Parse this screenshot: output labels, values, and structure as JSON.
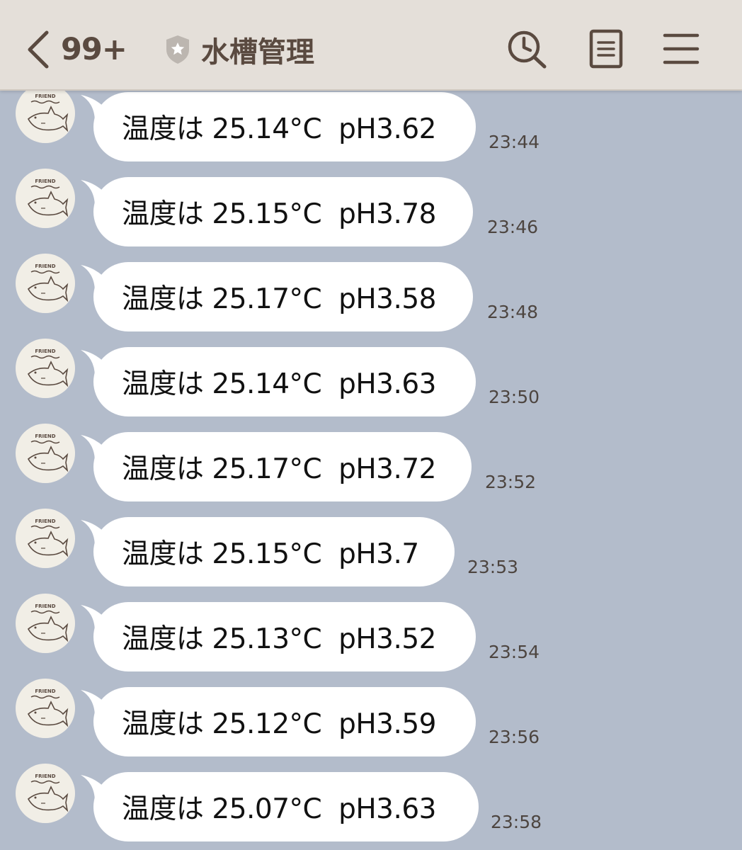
{
  "header": {
    "unread_count": "99+",
    "title": "水槽管理",
    "icons": [
      "back-chevron-icon",
      "shield-star-icon",
      "search-clock-icon",
      "notes-icon",
      "menu-icon"
    ],
    "background": "#e4dfd9",
    "text_color": "#5a4a40"
  },
  "chat": {
    "background": "#b3bccb",
    "avatar_label": "FRIEND",
    "avatar_icon": "shark-icon",
    "messages": [
      {
        "text": "温度は 25.14°C  pH3.62",
        "time": "23:44"
      },
      {
        "text": "温度は 25.15°C  pH3.78",
        "time": "23:46"
      },
      {
        "text": "温度は 25.17°C  pH3.58",
        "time": "23:48"
      },
      {
        "text": "温度は 25.14°C  pH3.63",
        "time": "23:50"
      },
      {
        "text": "温度は 25.17°C  pH3.72",
        "time": "23:52"
      },
      {
        "text": "温度は 25.15°C  pH3.7",
        "time": "23:53"
      },
      {
        "text": "温度は 25.13°C  pH3.52",
        "time": "23:54"
      },
      {
        "text": "温度は 25.12°C  pH3.59",
        "time": "23:56"
      },
      {
        "text": "温度は 25.07°C  pH3.63",
        "time": "23:58"
      }
    ]
  }
}
